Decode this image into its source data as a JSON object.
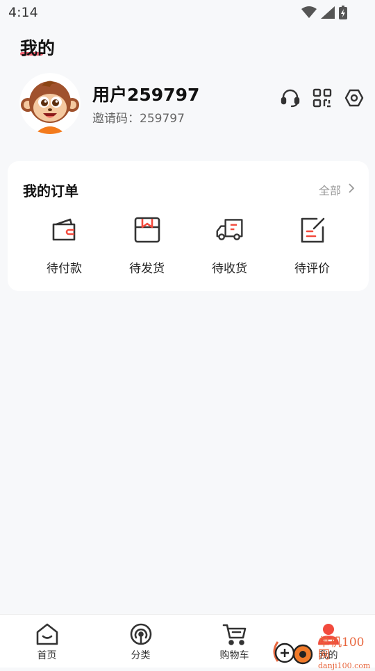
{
  "status": {
    "time": "4:14"
  },
  "header": {
    "title": "我的"
  },
  "profile": {
    "username": "用户259797",
    "invite_label": "邀请码：",
    "invite_code": "259797"
  },
  "orders": {
    "title": "我的订单",
    "view_all": "全部",
    "items": [
      {
        "label": "待付款",
        "icon": "wallet-icon"
      },
      {
        "label": "待发货",
        "icon": "package-icon"
      },
      {
        "label": "待收货",
        "icon": "truck-icon"
      },
      {
        "label": "待评价",
        "icon": "review-icon"
      }
    ]
  },
  "nav": {
    "items": [
      {
        "label": "首页",
        "icon": "home-icon"
      },
      {
        "label": "分类",
        "icon": "category-icon"
      },
      {
        "label": "购物车",
        "icon": "cart-icon"
      },
      {
        "label": "我的",
        "icon": "profile-icon",
        "active": true
      }
    ]
  },
  "watermark": {
    "title": "单机100网",
    "url": "danji100.com"
  },
  "colors": {
    "accent": "#f24a3d",
    "background": "#f7f8fa",
    "card": "#ffffff",
    "icon_dark": "#333333"
  }
}
